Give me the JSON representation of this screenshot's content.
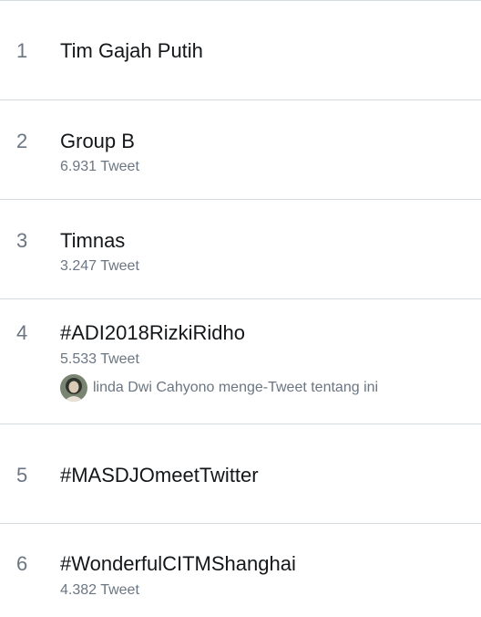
{
  "trends": [
    {
      "rank": "1",
      "name": "Tim Gajah Putih",
      "count": ""
    },
    {
      "rank": "2",
      "name": "Group B",
      "count": "6.931 Tweet"
    },
    {
      "rank": "3",
      "name": "Timnas",
      "count": "3.247 Tweet"
    },
    {
      "rank": "4",
      "name": "#ADI2018RizkiRidho",
      "count": "5.533 Tweet",
      "context": "linda Dwi Cahyono menge-Tweet tentang ini",
      "context_icon": "avatar"
    },
    {
      "rank": "5",
      "name": "#MASDJOmeetTwitter",
      "count": ""
    },
    {
      "rank": "6",
      "name": "#WonderfulCITMShanghai",
      "count": "4.382 Tweet"
    }
  ],
  "colors": {
    "text_primary": "#14171a",
    "text_secondary": "#6b7682",
    "divider": "#d6dbdf"
  }
}
